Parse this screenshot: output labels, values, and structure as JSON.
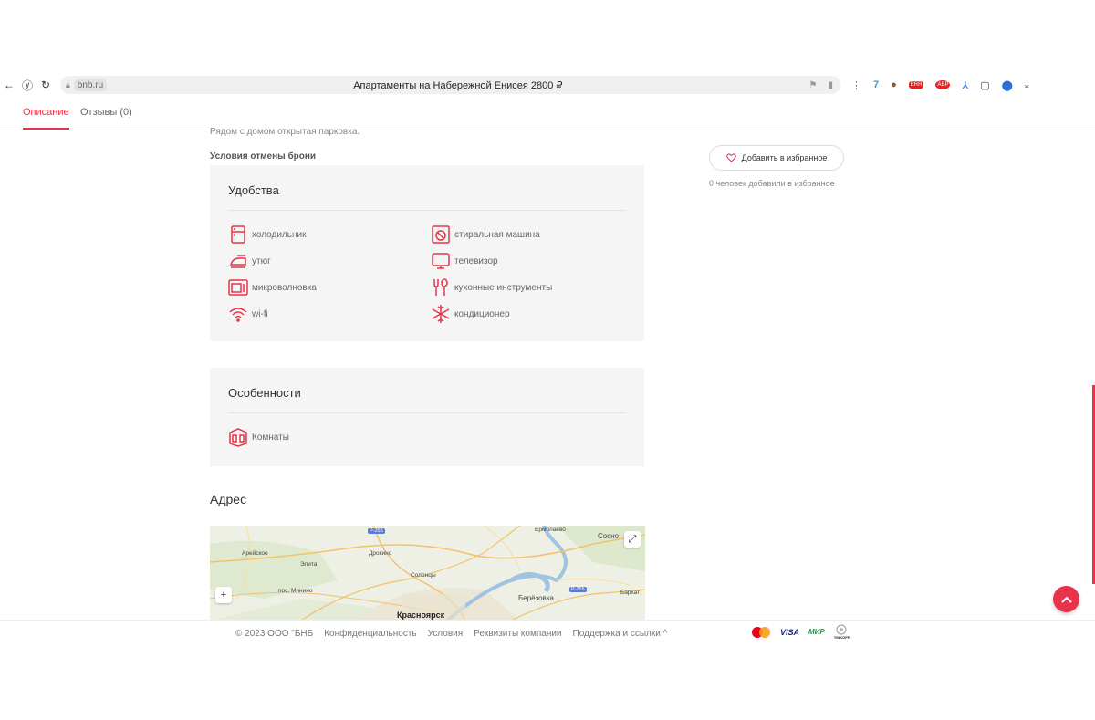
{
  "browser": {
    "url": "bnb.ru",
    "title": "Апартаменты на Набережной Енисея 2800 ₽"
  },
  "tabs": [
    {
      "label": "Описание",
      "active": true
    },
    {
      "label": "Отзывы (0)",
      "active": false
    }
  ],
  "description_cut": "Рядом с домом открытая парковка.",
  "cancel_title": "Условия отмены брони",
  "amenities": {
    "title": "Удобства",
    "items": [
      {
        "label": "холодильник",
        "icon": "fridge-icon"
      },
      {
        "label": "стиральная машина",
        "icon": "washing-machine-icon"
      },
      {
        "label": "утюг",
        "icon": "iron-icon"
      },
      {
        "label": "телевизор",
        "icon": "tv-icon"
      },
      {
        "label": "микроволновка",
        "icon": "microwave-icon"
      },
      {
        "label": "кухонные инструменты",
        "icon": "kitchen-tools-icon"
      },
      {
        "label": "wi-fi",
        "icon": "wifi-icon"
      },
      {
        "label": "кондиционер",
        "icon": "snowflake-icon"
      }
    ]
  },
  "features": {
    "title": "Особенности",
    "items": [
      {
        "label": "Комнаты",
        "icon": "rooms-icon"
      }
    ]
  },
  "address": {
    "title": "Адрес",
    "map_labels": {
      "arejskoe": "Арейское",
      "elita": "Элита",
      "drokino": "Дрокино",
      "solontsy": "Солонцы",
      "ermolaevo": "Ермолаево",
      "sosnovy": "Сосно",
      "minino": "пос. Минино",
      "berezovka": "Берёзовка",
      "barhatovo": "Бархат",
      "krasnoyarsk": "Красноярск",
      "road1": "Р-255",
      "road2": "Р-255"
    }
  },
  "favorite": {
    "button": "Добавить в избранное",
    "count_text": "0 человек добавили в избранное"
  },
  "footer": {
    "copyright": "© 2023 ООО \"БНБ",
    "links": [
      "Конфиденциальность",
      "Условия",
      "Реквизиты компании",
      "Поддержка и ссылки ^"
    ],
    "payments": {
      "visa": "VISA",
      "mir": "МИР",
      "tinkoff": "TINKOFF"
    }
  },
  "colors": {
    "accent": "#e8334a",
    "panel": "#f5f5f5"
  }
}
